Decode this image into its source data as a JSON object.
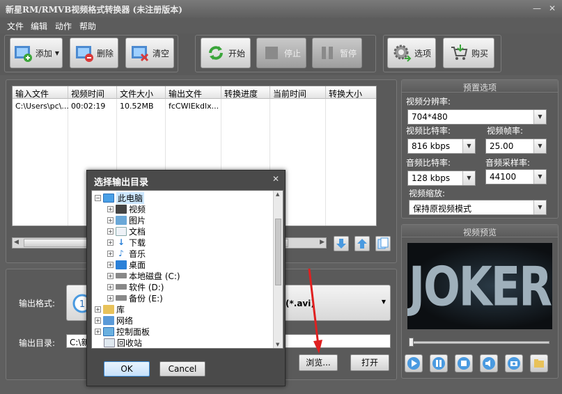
{
  "window": {
    "title": "新星RM/RMVB视频格式转换器  (未注册版本)",
    "minimize": "—",
    "close": "✕"
  },
  "menu": [
    "文件",
    "编辑",
    "动作",
    "帮助"
  ],
  "toolbar": {
    "add": "添加",
    "delete": "删除",
    "clear": "清空",
    "start": "开始",
    "stop": "停止",
    "pause": "暂停",
    "options": "选项",
    "buy": "购买"
  },
  "table": {
    "columns": [
      "输入文件",
      "视频时间",
      "文件大小",
      "输出文件",
      "转换进度",
      "当前时间",
      "转换大小"
    ],
    "rows": [
      [
        "C:\\Users\\pc\\...",
        "00:02:19",
        "10.52MB",
        "fcCWIEkdlx...",
        "",
        "",
        ""
      ]
    ]
  },
  "output": {
    "format_label": "输出格式:",
    "format_value": "频(*.avi)",
    "dir_label": "输出目录:",
    "dir_value": "C:\\新",
    "browse": "浏览...",
    "open": "打开"
  },
  "presets": {
    "header": "预置选项",
    "resolution_label": "视频分辨率:",
    "resolution": "704*480",
    "vbitrate_label": "视频比特率:",
    "vbitrate": "816 kbps",
    "fps_label": "视频帧率:",
    "fps": "25.00",
    "abitrate_label": "音频比特率:",
    "abitrate": "128 kbps",
    "samplerate_label": "音频采样率:",
    "samplerate": "44100",
    "scale_label": "视频缩放:",
    "scale": "保持原视频模式"
  },
  "preview": {
    "header": "视频预览",
    "poster_text": "JOKER",
    "slider_position": 0.0
  },
  "dialog": {
    "title": "选择输出目录",
    "ok": "OK",
    "cancel": "Cancel",
    "tree": {
      "root": "此电脑",
      "children": [
        "视频",
        "图片",
        "文档",
        "下载",
        "音乐",
        "桌面",
        "本地磁盘 (C:)",
        "软件 (D:)",
        "备份 (E:)"
      ],
      "others": [
        "库",
        "网络",
        "控制面板",
        "回收站"
      ]
    }
  },
  "colors": {
    "accent_green": "#3aa53a",
    "stop_red": "#d83a3a",
    "folder": "#e8c25a",
    "selection": "#cde8ff",
    "arrow": "#e02020"
  }
}
